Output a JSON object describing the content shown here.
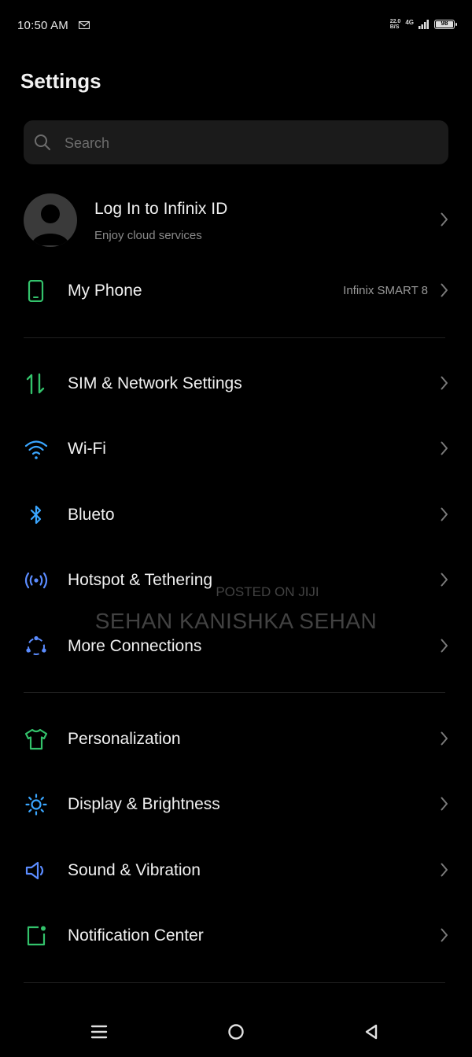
{
  "status_bar": {
    "time": "10:50 AM",
    "speed_value": "22.0",
    "speed_unit": "B/S",
    "network": "4G",
    "battery": "98",
    "battery_level": 0.98
  },
  "page": {
    "title": "Settings"
  },
  "search": {
    "placeholder": "Search"
  },
  "account": {
    "title": "Log In to Infinix ID",
    "subtitle": "Enjoy cloud services"
  },
  "groups": [
    {
      "items": [
        {
          "label": "My Phone",
          "value": "Infinix SMART 8",
          "icon": "phone-icon",
          "color": "#33c26b"
        }
      ]
    },
    {
      "items": [
        {
          "label": "SIM & Network Settings",
          "icon": "sim-network-icon",
          "color": "#33c26b"
        },
        {
          "label": "Wi-Fi",
          "icon": "wifi-icon",
          "color": "#3aa6ff"
        },
        {
          "label": "Blueto",
          "icon": "bluetooth-icon",
          "color": "#3aa6ff"
        },
        {
          "label": "Hotspot & Tethering",
          "icon": "hotspot-icon",
          "color": "#5b8cff"
        },
        {
          "label": "More Connections",
          "icon": "connections-icon",
          "color": "#5b8cff"
        }
      ]
    },
    {
      "items": [
        {
          "label": "Personalization",
          "icon": "shirt-icon",
          "color": "#33c26b"
        },
        {
          "label": "Display & Brightness",
          "icon": "sun-icon",
          "color": "#3aa6ff"
        },
        {
          "label": "Sound & Vibration",
          "icon": "speaker-icon",
          "color": "#5b8cff"
        },
        {
          "label": "Notification Center",
          "icon": "notification-icon",
          "color": "#33c26b"
        }
      ]
    }
  ],
  "watermark": {
    "line1": "POSTED ON JIJI",
    "line2": "SEHAN KANISHKA SEHAN"
  },
  "nav": {
    "recents": "menu-icon",
    "home": "home-icon",
    "back": "back-icon"
  }
}
